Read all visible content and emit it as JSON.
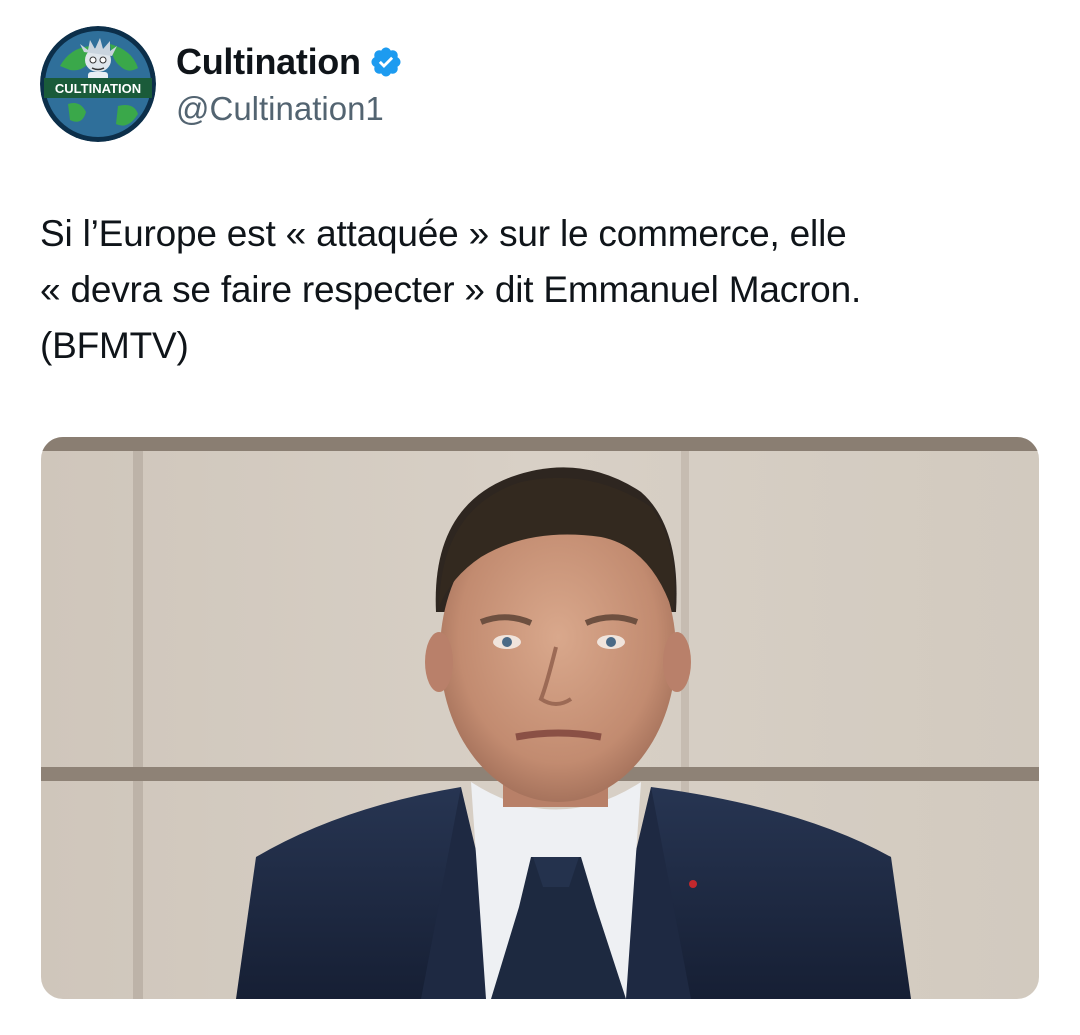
{
  "author": {
    "display_name": "Cultination",
    "handle": "@Cultination1",
    "verified": true,
    "avatar_label": "CULTINATION",
    "avatar_icon": "globe-cartoon-avatar",
    "verified_icon": "verified-badge-icon"
  },
  "tweet": {
    "text": "Si l’Europe est « attaquée » sur le commerce, elle\n« devra se faire respecter » dit Emmanuel Macron.\n(BFMTV)"
  },
  "media": {
    "type": "photo",
    "subject": "man-in-suit-portrait"
  },
  "colors": {
    "text": "#0f1419",
    "secondary_text": "#536471",
    "verified_blue": "#1d9bf0",
    "background": "#ffffff",
    "avatar_ocean": "#2f6f9a",
    "avatar_land": "#3aa84a",
    "avatar_banner": "#1a5b3a"
  }
}
